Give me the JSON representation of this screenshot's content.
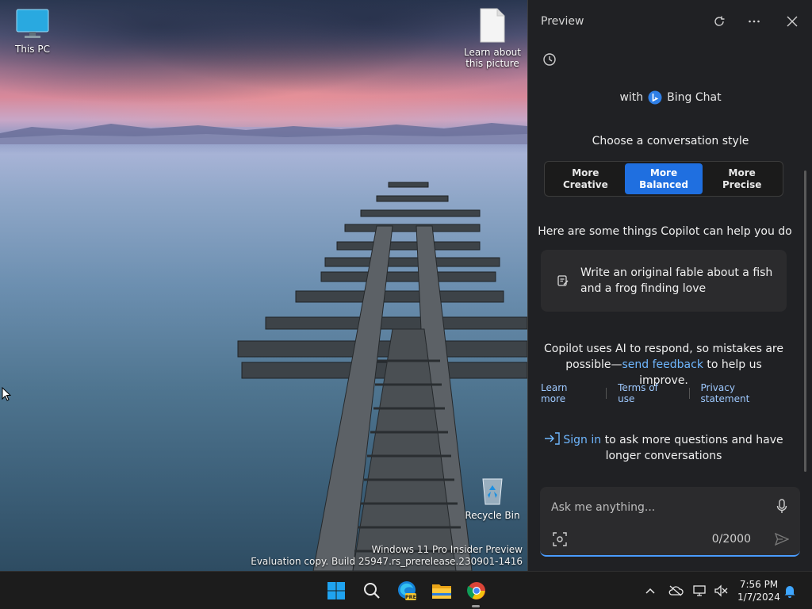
{
  "desktop": {
    "icons": [
      {
        "label": "This PC"
      },
      {
        "label": "Learn about this picture"
      },
      {
        "label": "Recycle Bin"
      }
    ],
    "watermark": {
      "line1": "Windows 11 Pro Insider Preview",
      "line2": "Evaluation copy. Build 25947.rs_prerelease.230901-1416"
    }
  },
  "pane": {
    "title": "Preview",
    "with_prefix": "with",
    "bing_label": "Bing Chat",
    "choose_label": "Choose a conversation style",
    "styles": [
      {
        "line1": "More",
        "line2": "Creative",
        "active": false
      },
      {
        "line1": "More",
        "line2": "Balanced",
        "active": true
      },
      {
        "line1": "More",
        "line2": "Precise",
        "active": false
      }
    ],
    "help_title": "Here are some things Copilot can help you do",
    "suggestion": "Write an original fable about a fish and a frog finding love",
    "disclaimer": {
      "before": "Copilot uses AI to respond, so mistakes are possible—",
      "link": "send feedback",
      "after": " to help us improve."
    },
    "links": [
      "Learn more",
      "Terms of use",
      "Privacy statement"
    ],
    "signin": {
      "link": "Sign in",
      "rest": " to ask more questions and have longer conversations"
    },
    "input": {
      "placeholder": "Ask me anything...",
      "counter": "0/2000"
    },
    "accent": "#1f6fe0"
  },
  "taskbar": {
    "apps": [
      "start-icon",
      "search-icon",
      "edge-beta-icon",
      "file-explorer-icon",
      "chrome-icon"
    ],
    "edge_badge": "PRE",
    "clock": {
      "time": "7:56 PM",
      "date": "1/7/2024"
    }
  }
}
